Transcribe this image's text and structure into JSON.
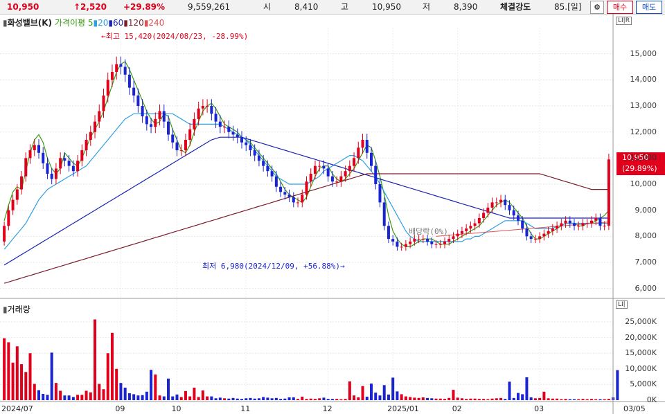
{
  "header": {
    "price": "10,950",
    "change": "↑2,520",
    "change_pct": "+29.89%",
    "volume": "9,559,261",
    "open_label": "시",
    "open": "8,410",
    "high_label": "고",
    "high": "10,950",
    "low_label": "저",
    "low": "8,390",
    "strength_label": "체결강도",
    "strength": "85.[일]",
    "sell_btn": "매수",
    "buy_btn": "매도"
  },
  "legend": {
    "stock": "화성밸브(K)",
    "ma_label": "가격이평",
    "ma": [
      {
        "period": "5",
        "color": "#3a9a10"
      },
      {
        "period": "20",
        "color": "#2f9fe0"
      },
      {
        "period": "60",
        "color": "#1a24b0"
      },
      {
        "period": "120",
        "color": "#7a1c2c"
      },
      {
        "period": "240",
        "color": "#e05050"
      }
    ]
  },
  "volume_legend": "거래량",
  "annotations": {
    "high": "←최고 15,420(2024/08/23, -28.99%)",
    "low": "최저 6,980(2024/12/09, +56.88%)→",
    "dividend": "배당락(0%)"
  },
  "current_tag": {
    "price": "10,950",
    "pct": "(29.89%)"
  },
  "colors": {
    "up": "#e0001b",
    "down": "#1a24d0"
  },
  "chart_data": [
    {
      "type": "candlestick",
      "title": "화성밸브(K)",
      "x_labels": [
        "2024/07",
        "09",
        "10",
        "11",
        "12",
        "2025/01",
        "02",
        "03"
      ],
      "x_end_label": "03/05",
      "y_ticks": [
        6000,
        7000,
        8000,
        9000,
        10000,
        11000,
        12000,
        13000,
        14000,
        15000
      ],
      "y_tick_labels": [
        "6,000",
        "7,000",
        "8,000",
        "9,000",
        "10,000",
        "11,000",
        "12,000",
        "13,000",
        "14,000",
        "15,000"
      ],
      "ylim": [
        5700,
        16000
      ],
      "series": [
        {
          "name": "5",
          "values": [
            8600,
            9200,
            9700,
            9900,
            9800,
            10500,
            11200,
            11700,
            11900,
            11600,
            11000,
            10600,
            10400,
            10600,
            11200,
            11000,
            10800,
            10700,
            11000,
            11400,
            11800,
            12100,
            12400,
            12800,
            13300,
            13800,
            14300,
            14600,
            14700,
            14400,
            14000,
            13600,
            13200,
            12800,
            12500,
            12300,
            12400,
            12700,
            12600,
            12100,
            11700,
            11300,
            11200,
            11500,
            12000,
            12400,
            12800,
            13000,
            13100,
            12900,
            12600,
            12300,
            12200,
            12100,
            12000,
            11800,
            11700,
            11600,
            11400,
            11200,
            11000,
            10800,
            10600,
            10400,
            10100,
            9800,
            9600,
            9500,
            9400,
            9300,
            9500,
            9900,
            10300,
            10600,
            10700,
            10700,
            10400,
            10200,
            10100,
            10200,
            10400,
            10600,
            10900,
            11200,
            11500,
            11400,
            10900,
            10300,
            9600,
            8800,
            8200,
            7900,
            7700,
            7600,
            7600,
            7700,
            7800,
            7900,
            7900,
            7900,
            7800,
            7700,
            7700,
            7700,
            7800,
            7900,
            8000,
            8100,
            8200,
            8300,
            8400,
            8600,
            8800,
            9000,
            9200,
            9300,
            9400,
            9300,
            9100,
            8900,
            8700,
            8400,
            8100,
            7900,
            7900,
            8000,
            8100,
            8200,
            8300,
            8400,
            8500,
            8500,
            8500,
            8400,
            8400,
            8500,
            8500,
            8600,
            8700,
            8800,
            9000
          ]
        },
        {
          "name": "20",
          "values": [
            7500,
            7700,
            7900,
            8100,
            8300,
            8500,
            8800,
            9100,
            9400,
            9600,
            9800,
            9900,
            10000,
            10100,
            10200,
            10300,
            10400,
            10500,
            10600,
            10700,
            10900,
            11100,
            11300,
            11500,
            11700,
            11900,
            12100,
            12300,
            12500,
            12600,
            12700,
            12700,
            12700,
            12700,
            12700,
            12700,
            12700,
            12700,
            12700,
            12700,
            12600,
            12500,
            12400,
            12300,
            12300,
            12300,
            12300,
            12300,
            12300,
            12300,
            12300,
            12200,
            12100,
            12000,
            11900,
            11800,
            11700,
            11500,
            11300,
            11100,
            10900,
            10700,
            10500,
            10300,
            10200,
            10100,
            10000,
            10000,
            10000,
            10000,
            10000,
            10100,
            10200,
            10300,
            10500,
            10600,
            10700,
            10800,
            10900,
            11000,
            11100,
            11100,
            11000,
            10900,
            10700,
            10500,
            10300,
            10000,
            9700,
            9400,
            9100,
            8800,
            8500,
            8200,
            8000,
            7900,
            7800,
            7800,
            7800,
            7800,
            7800,
            7800,
            7800,
            7800,
            7800,
            7800,
            7800,
            7900,
            7900,
            8000,
            8000,
            8100,
            8200,
            8300,
            8400,
            8500,
            8600,
            8600,
            8600,
            8600,
            8600,
            8500,
            8400,
            8300,
            8300,
            8300,
            8300,
            8300,
            8400,
            8400,
            8500,
            8500,
            8500,
            8500,
            8500,
            8500,
            8500,
            8500,
            8500,
            8500,
            8500
          ]
        },
        {
          "name": "60",
          "values": [
            6900,
            7000,
            7100,
            7200,
            7300,
            7400,
            7500,
            7600,
            7700,
            7800,
            7900,
            8000,
            8100,
            8200,
            8300,
            8400,
            8500,
            8600,
            8700,
            8800,
            8900,
            9000,
            9100,
            9200,
            9300,
            9400,
            9500,
            9600,
            9700,
            9800,
            9900,
            10000,
            10100,
            10200,
            10300,
            10400,
            10500,
            10600,
            10700,
            10800,
            10900,
            11000,
            11100,
            11200,
            11300,
            11400,
            11500,
            11600,
            11700,
            11750,
            11800,
            11800,
            11800,
            11800,
            11800,
            11800,
            11750,
            11700,
            11650,
            11600,
            11550,
            11500,
            11450,
            11400,
            11350,
            11300,
            11250,
            11200,
            11150,
            11100,
            11050,
            11000,
            10950,
            10900,
            10850,
            10800,
            10750,
            10700,
            10650,
            10600,
            10550,
            10500,
            10450,
            10400,
            10350,
            10300,
            10250,
            10200,
            10150,
            10100,
            10050,
            10000,
            9950,
            9900,
            9850,
            9800,
            9750,
            9700,
            9650,
            9600,
            9550,
            9500,
            9450,
            9400,
            9350,
            9300,
            9250,
            9200,
            9150,
            9100,
            9050,
            9000,
            8950,
            8900,
            8850,
            8800,
            8750,
            8700,
            8700,
            8700,
            8700,
            8700,
            8700,
            8700,
            8700,
            8700,
            8700,
            8700,
            8700,
            8700,
            8700,
            8700,
            8700,
            8700,
            8700,
            8700,
            8700,
            8700,
            8700,
            8700,
            8700
          ]
        },
        {
          "name": "120",
          "values": [
            6200,
            6250,
            6300,
            6350,
            6400,
            6450,
            6500,
            6550,
            6600,
            6650,
            6700,
            6750,
            6800,
            6850,
            6900,
            6950,
            7000,
            7050,
            7100,
            7150,
            7200,
            7250,
            7300,
            7350,
            7400,
            7450,
            7500,
            7550,
            7600,
            7650,
            7700,
            7750,
            7800,
            7850,
            7900,
            7950,
            8000,
            8050,
            8100,
            8150,
            8200,
            8250,
            8300,
            8350,
            8400,
            8450,
            8500,
            8550,
            8600,
            8650,
            8700,
            8750,
            8800,
            8850,
            8900,
            8950,
            9000,
            9050,
            9100,
            9150,
            9200,
            9250,
            9300,
            9350,
            9400,
            9450,
            9500,
            9550,
            9600,
            9650,
            9700,
            9750,
            9800,
            9850,
            9900,
            9950,
            10000,
            10050,
            10100,
            10150,
            10200,
            10250,
            10300,
            10350,
            10400,
            10400,
            10400,
            10400,
            10400,
            10400,
            10400,
            10400,
            10400,
            10400,
            10400,
            10400,
            10400,
            10400,
            10400,
            10400,
            10400,
            10400,
            10400,
            10400,
            10400,
            10400,
            10400,
            10400,
            10400,
            10400,
            10400,
            10400,
            10400,
            10400,
            10400,
            10400,
            10400,
            10400,
            10400,
            10400,
            10400,
            10400,
            10400,
            10400,
            10400,
            10350,
            10300,
            10250,
            10200,
            10150,
            10100,
            10050,
            10000,
            9950,
            9900,
            9850,
            9800,
            9800,
            9800,
            9800,
            9800
          ]
        }
      ],
      "candles": {
        "open": [
          7800,
          8400,
          9000,
          9400,
          9800,
          10300,
          11000,
          11300,
          11500,
          11200,
          10800,
          10400,
          10200,
          10600,
          11000,
          10900,
          10700,
          10500,
          10900,
          11300,
          11700,
          12000,
          12400,
          12800,
          13400,
          14000,
          14300,
          14600,
          14500,
          14200,
          13700,
          13400,
          13000,
          12600,
          12300,
          12200,
          12500,
          12800,
          12400,
          11900,
          11600,
          11300,
          11300,
          11700,
          12100,
          12500,
          12900,
          13000,
          13000,
          12700,
          12400,
          12200,
          12200,
          12000,
          11900,
          11800,
          11600,
          11500,
          11300,
          11100,
          10900,
          10700,
          10500,
          10300,
          9900,
          9700,
          9600,
          9500,
          9300,
          9300,
          9600,
          10100,
          10400,
          10700,
          10700,
          10600,
          10300,
          10100,
          10100,
          10300,
          10500,
          10700,
          11000,
          11400,
          11700,
          11200,
          10700,
          10000,
          9300,
          8400,
          7900,
          7800,
          7600,
          7600,
          7700,
          7800,
          7900,
          7900,
          7900,
          7800,
          7700,
          7700,
          7700,
          7800,
          7900,
          8000,
          8100,
          8200,
          8300,
          8400,
          8500,
          8700,
          8900,
          9100,
          9300,
          9300,
          9400,
          9200,
          9000,
          8800,
          8600,
          8300,
          8000,
          7900,
          7900,
          8000,
          8100,
          8200,
          8300,
          8400,
          8500,
          8600,
          8500,
          8400,
          8400,
          8500,
          8500,
          8600,
          8700,
          8400,
          8410
        ],
        "close": [
          8400,
          9000,
          9400,
          9800,
          10300,
          11000,
          11300,
          11500,
          11200,
          10800,
          10400,
          10200,
          10600,
          11000,
          10900,
          10700,
          10500,
          10900,
          11300,
          11700,
          12000,
          12400,
          12800,
          13400,
          14000,
          14300,
          14600,
          14500,
          14200,
          13700,
          13400,
          13000,
          12600,
          12300,
          12200,
          12500,
          12800,
          12400,
          11900,
          11600,
          11300,
          11300,
          11700,
          12100,
          12500,
          12900,
          13000,
          13000,
          12700,
          12400,
          12200,
          12200,
          12000,
          11900,
          11800,
          11600,
          11500,
          11300,
          11100,
          10900,
          10700,
          10500,
          10300,
          9900,
          9700,
          9600,
          9500,
          9300,
          9300,
          9600,
          10100,
          10400,
          10700,
          10700,
          10600,
          10300,
          10100,
          10100,
          10300,
          10500,
          10700,
          11000,
          11400,
          11700,
          11200,
          10700,
          10000,
          9300,
          8400,
          7900,
          7800,
          7600,
          7600,
          7700,
          7800,
          7900,
          7900,
          7900,
          7800,
          7700,
          7700,
          7700,
          7800,
          7900,
          8000,
          8100,
          8200,
          8300,
          8400,
          8500,
          8700,
          8900,
          9100,
          9300,
          9300,
          9400,
          9200,
          9000,
          8800,
          8600,
          8300,
          8000,
          7900,
          7900,
          8000,
          8100,
          8200,
          8300,
          8400,
          8500,
          8600,
          8500,
          8400,
          8400,
          8500,
          8500,
          8600,
          8700,
          8400,
          8410,
          10950
        ]
      },
      "volume": {
        "y_ticks": [
          "0K",
          "5,000K",
          "10,000K",
          "15,000K",
          "20,000K",
          "25,000K"
        ],
        "ylim": [
          0,
          27000
        ],
        "values": [
          19800,
          18500,
          12000,
          17200,
          11500,
          9000,
          15000,
          5200,
          3200,
          2000,
          1700,
          15200,
          5500,
          3000,
          1500,
          1500,
          1000,
          1700,
          1700,
          3000,
          2500,
          25800,
          5200,
          3500,
          15000,
          21500,
          10000,
          5500,
          4000,
          2200,
          1900,
          1500,
          1600,
          2700,
          9700,
          8200,
          1500,
          1200,
          6900,
          1200,
          1800,
          1000,
          2900,
          1200,
          4000,
          1000,
          3100,
          1200,
          1200,
          600,
          800,
          600,
          500,
          700,
          500,
          400,
          600,
          700,
          500,
          600,
          1000,
          800,
          600,
          700,
          400,
          500,
          900,
          900,
          400,
          1100,
          400,
          500,
          400,
          600,
          800,
          400,
          400,
          400,
          300,
          400,
          6000,
          1500,
          900,
          4500,
          1100,
          5300,
          2400,
          1500,
          4800,
          1800,
          7200,
          2800,
          1900,
          1200,
          1000,
          800,
          700,
          900,
          700,
          600,
          500,
          500,
          400,
          700,
          3300,
          800,
          600,
          400,
          500,
          500,
          400,
          400,
          300,
          500,
          600,
          700,
          400,
          5900,
          700,
          2300,
          1900,
          7300,
          900,
          600,
          700,
          2700,
          600,
          500,
          500,
          300,
          400,
          300,
          300,
          300,
          400,
          300,
          400,
          300,
          300,
          300,
          400,
          900,
          9600
        ]
      }
    }
  ]
}
